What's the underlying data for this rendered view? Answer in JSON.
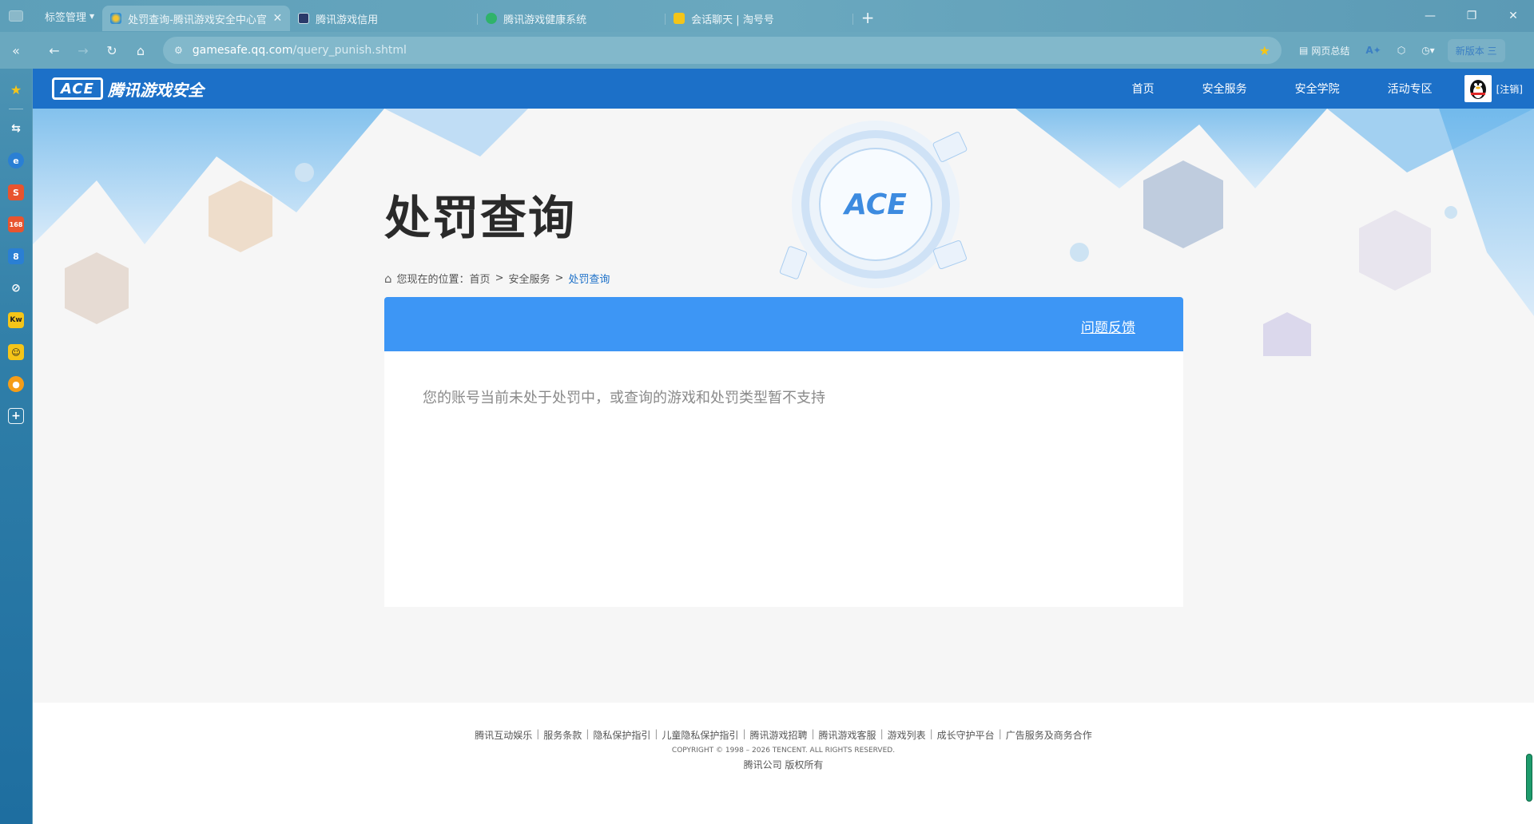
{
  "browser": {
    "tab_manager_label": "标签管理",
    "tabs": [
      {
        "title": "处罚查询-腾讯游戏安全中心官",
        "active": true
      },
      {
        "title": "腾讯游戏信用",
        "active": false
      },
      {
        "title": "腾讯游戏健康系统",
        "active": false
      },
      {
        "title": "会话聊天 | 淘号号",
        "active": false
      }
    ],
    "url_host": "gamesafe.qq.com",
    "url_path": "/query_punish.shtml",
    "page_summary_label": "网页总结",
    "new_version_label": "新版本 三"
  },
  "site": {
    "logo_mark": "ACE",
    "logo_text": "腾讯游戏安全",
    "nav": [
      "首页",
      "安全服务",
      "安全学院",
      "活动专区"
    ],
    "logout_label": "[注销]",
    "brand_color": "#1c70c8"
  },
  "main": {
    "title": "处罚查询",
    "breadcrumb": {
      "prefix": "您现在的位置：",
      "items": [
        "首页",
        "安全服务",
        "处罚查询"
      ],
      "separator": ">"
    },
    "feedback_label": "问题反馈",
    "message": "您的账号当前未处于处罚中，或查询的游戏和处罚类型暂不支持"
  },
  "footer": {
    "links": [
      "腾讯互动娱乐",
      "服务条款",
      "隐私保护指引",
      "儿童隐私保护指引",
      "腾讯游戏招聘",
      "腾讯游戏客服",
      "游戏列表",
      "成长守护平台",
      "广告服务及商务合作"
    ],
    "copyright": "COPYRIGHT © 1998 – 2026 TENCENT. ALL RIGHTS RESERVED.",
    "rights": "腾讯公司 版权所有"
  }
}
